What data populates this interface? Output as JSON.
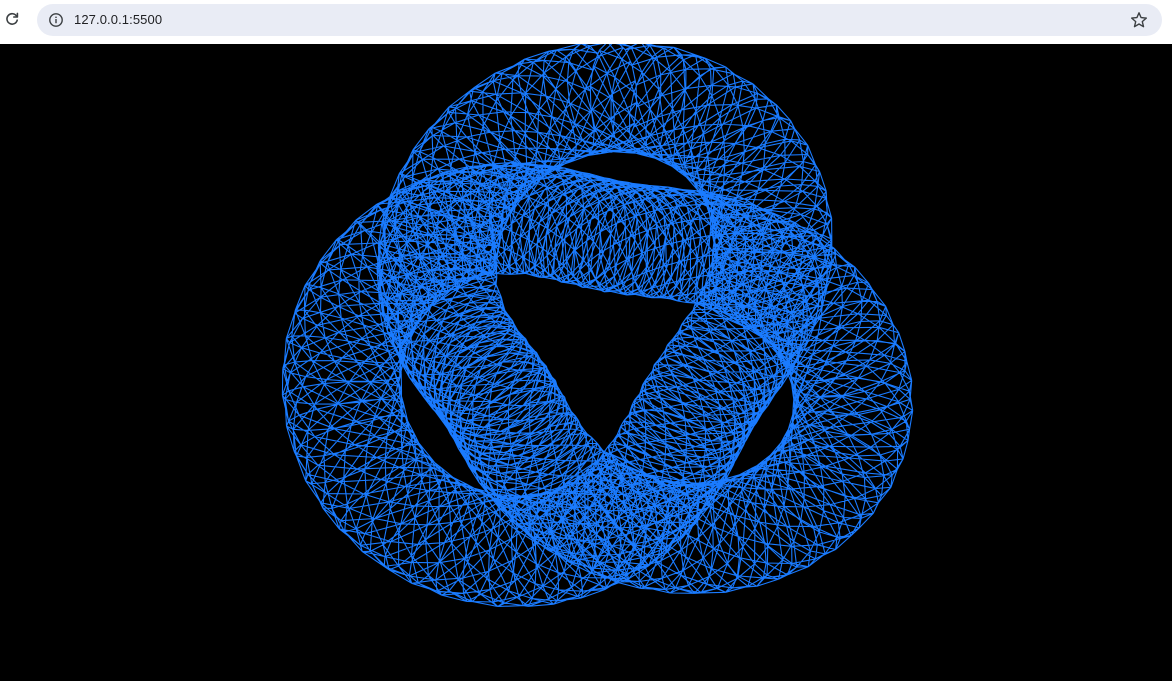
{
  "browser": {
    "url": "127.0.0.1:5500",
    "icons": {
      "reload": "reload-icon",
      "site_info": "info-icon",
      "bookmark": "star-icon"
    }
  },
  "scene": {
    "object": "torus-knot-wireframe",
    "background_color": "#000000",
    "wireframe_color": "#1a7bff"
  }
}
